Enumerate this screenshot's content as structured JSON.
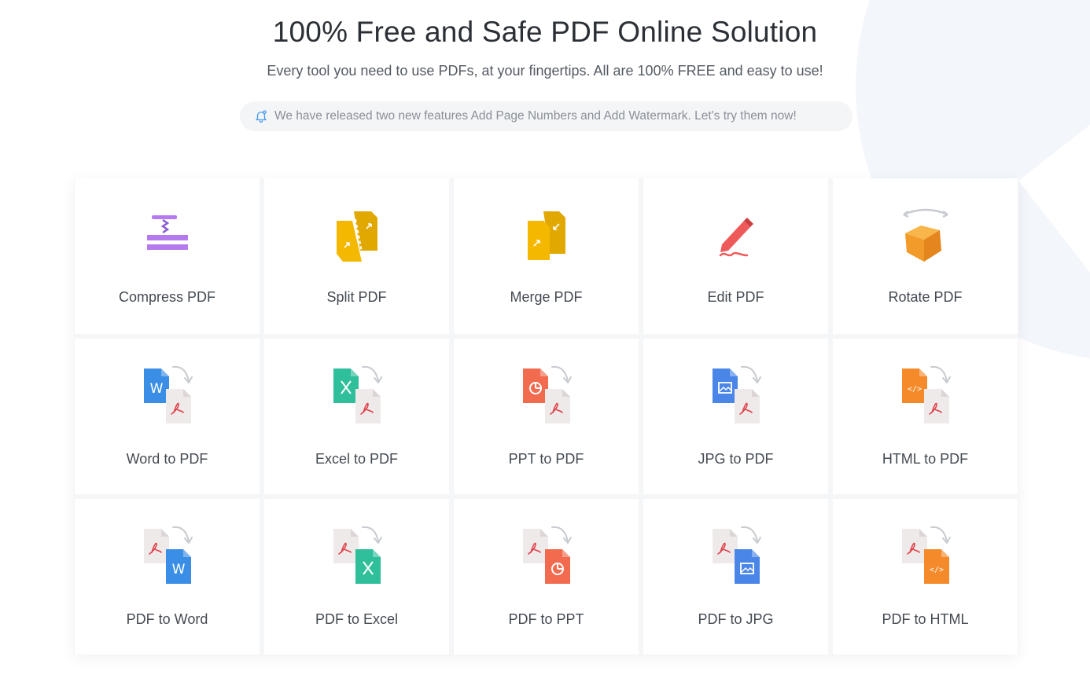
{
  "hero": {
    "title": "100% Free and Safe PDF Online Solution",
    "subtitle": "Every tool you need to use PDFs, at your fingertips. All are 100% FREE and easy to use!",
    "notice": "We have released two new features Add Page Numbers and Add Watermark. Let's try them now!"
  },
  "tools": [
    {
      "label": "Compress PDF",
      "icon": "compress-icon"
    },
    {
      "label": "Split PDF",
      "icon": "split-icon"
    },
    {
      "label": "Merge PDF",
      "icon": "merge-icon"
    },
    {
      "label": "Edit PDF",
      "icon": "edit-pencil-icon"
    },
    {
      "label": "Rotate PDF",
      "icon": "rotate-cube-icon"
    },
    {
      "label": "Word to PDF",
      "icon": "word-to-pdf-icon"
    },
    {
      "label": "Excel to PDF",
      "icon": "excel-to-pdf-icon"
    },
    {
      "label": "PPT to PDF",
      "icon": "ppt-to-pdf-icon"
    },
    {
      "label": "JPG to PDF",
      "icon": "jpg-to-pdf-icon"
    },
    {
      "label": "HTML to PDF",
      "icon": "html-to-pdf-icon"
    },
    {
      "label": "PDF to Word",
      "icon": "pdf-to-word-icon"
    },
    {
      "label": "PDF to Excel",
      "icon": "pdf-to-excel-icon"
    },
    {
      "label": "PDF to PPT",
      "icon": "pdf-to-ppt-icon"
    },
    {
      "label": "PDF to JPG",
      "icon": "pdf-to-jpg-icon"
    },
    {
      "label": "PDF to HTML",
      "icon": "pdf-to-html-icon"
    }
  ],
  "colors": {
    "compress": "#b57bee",
    "split_merge": "#f5b800",
    "edit": "#ee5a5a",
    "rotate": "#f29b2a",
    "word": "#3a8ee6",
    "excel": "#2fbf9b",
    "ppt": "#f26b4f",
    "jpg": "#4a86e8",
    "html": "#f48a2a",
    "pdf_doc": "#efeaea",
    "pdf_mark": "#e0424b",
    "arrow": "#c8cbd0",
    "bell": "#4a9cf0"
  }
}
